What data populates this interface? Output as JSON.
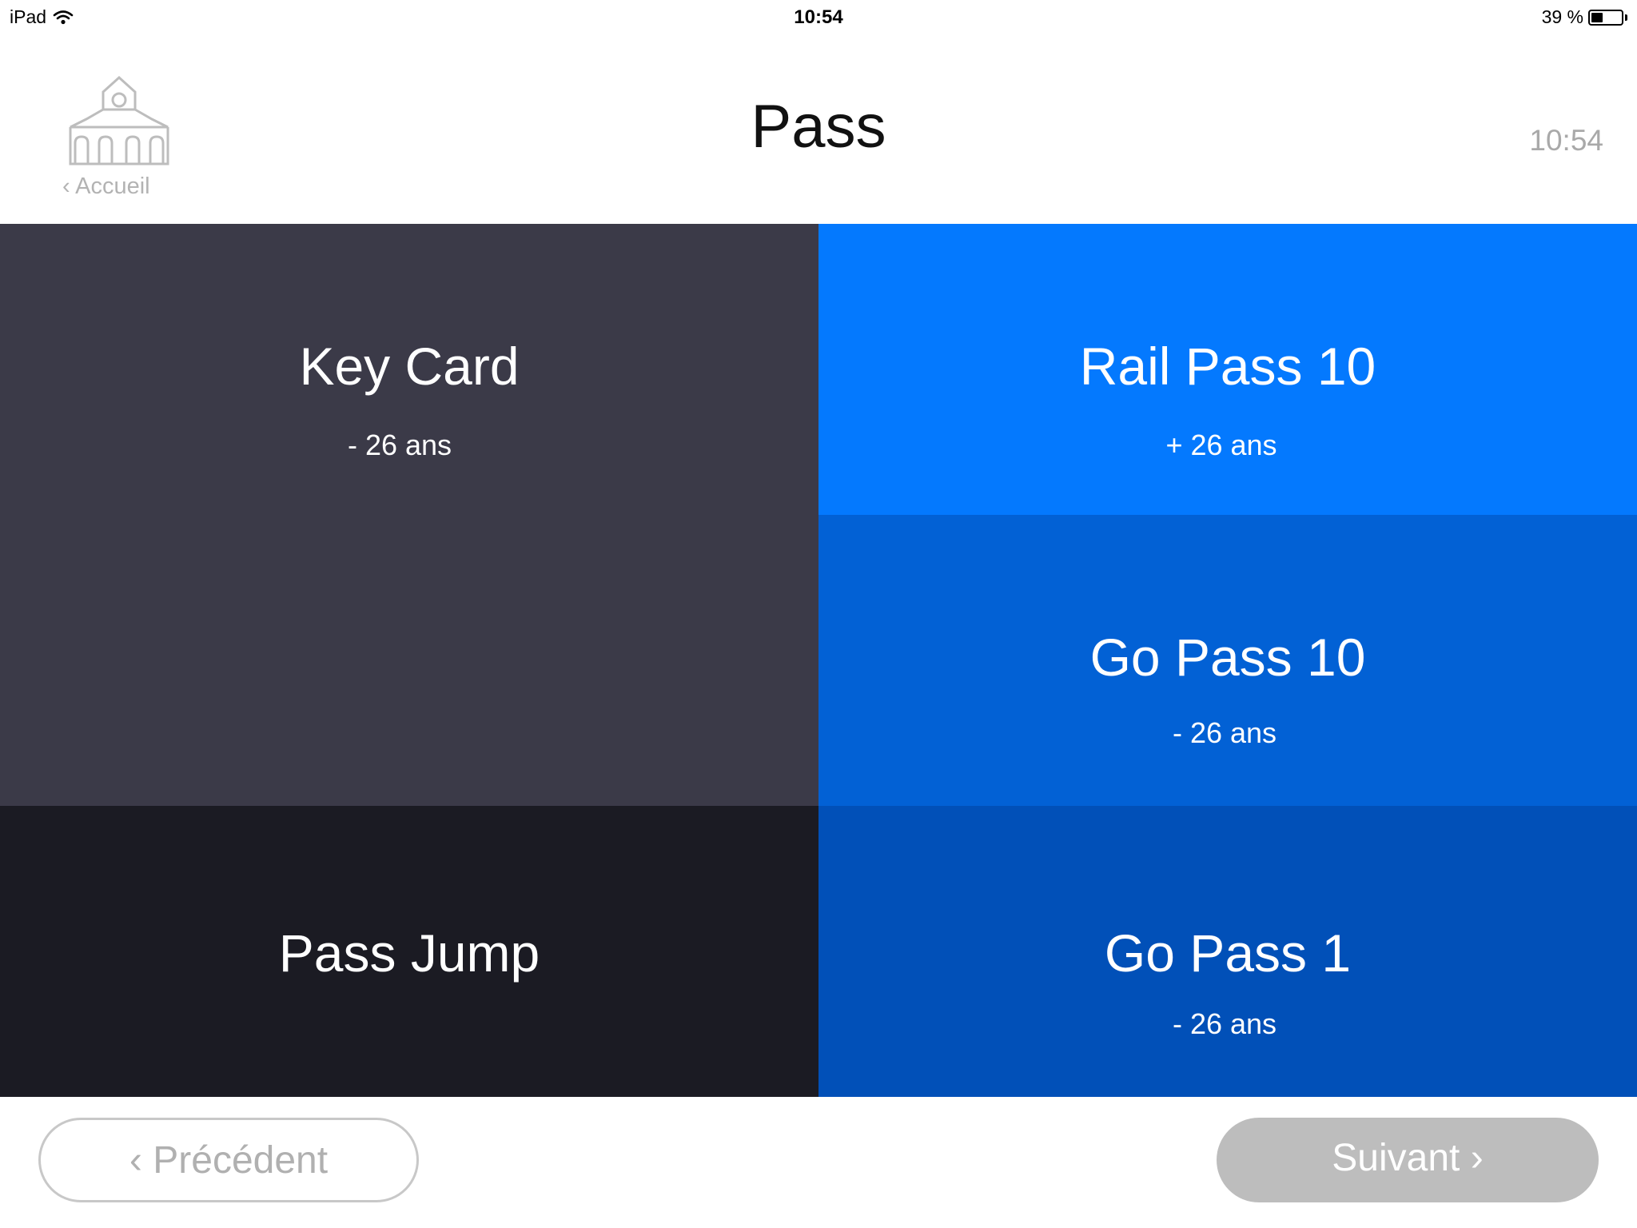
{
  "status_bar": {
    "device": "iPad",
    "time": "10:54",
    "battery_text": "39 %",
    "battery_level": 0.39
  },
  "header": {
    "home_label": "‹ Accueil",
    "title": "Pass",
    "clock": "10:54"
  },
  "tiles": [
    {
      "title": "Key Card",
      "subtitle": "- 26 ans",
      "color": "#3b3a48"
    },
    {
      "title": "Pass Jump",
      "subtitle": "",
      "color": "#1b1b23"
    },
    {
      "title": "Rail Pass 10",
      "subtitle": "+ 26 ans",
      "color": "#0479fe"
    },
    {
      "title": "Go Pass 10",
      "subtitle": "- 26 ans",
      "color": "#0261d5"
    },
    {
      "title": "Go Pass 1",
      "subtitle": "- 26 ans",
      "color": "#0150b8"
    }
  ],
  "footer": {
    "prev_label": "‹ Précédent",
    "next_label": "Suivant ›"
  },
  "icons": {
    "home": "station-building-icon",
    "wifi": "wifi-icon",
    "battery": "battery-icon"
  }
}
